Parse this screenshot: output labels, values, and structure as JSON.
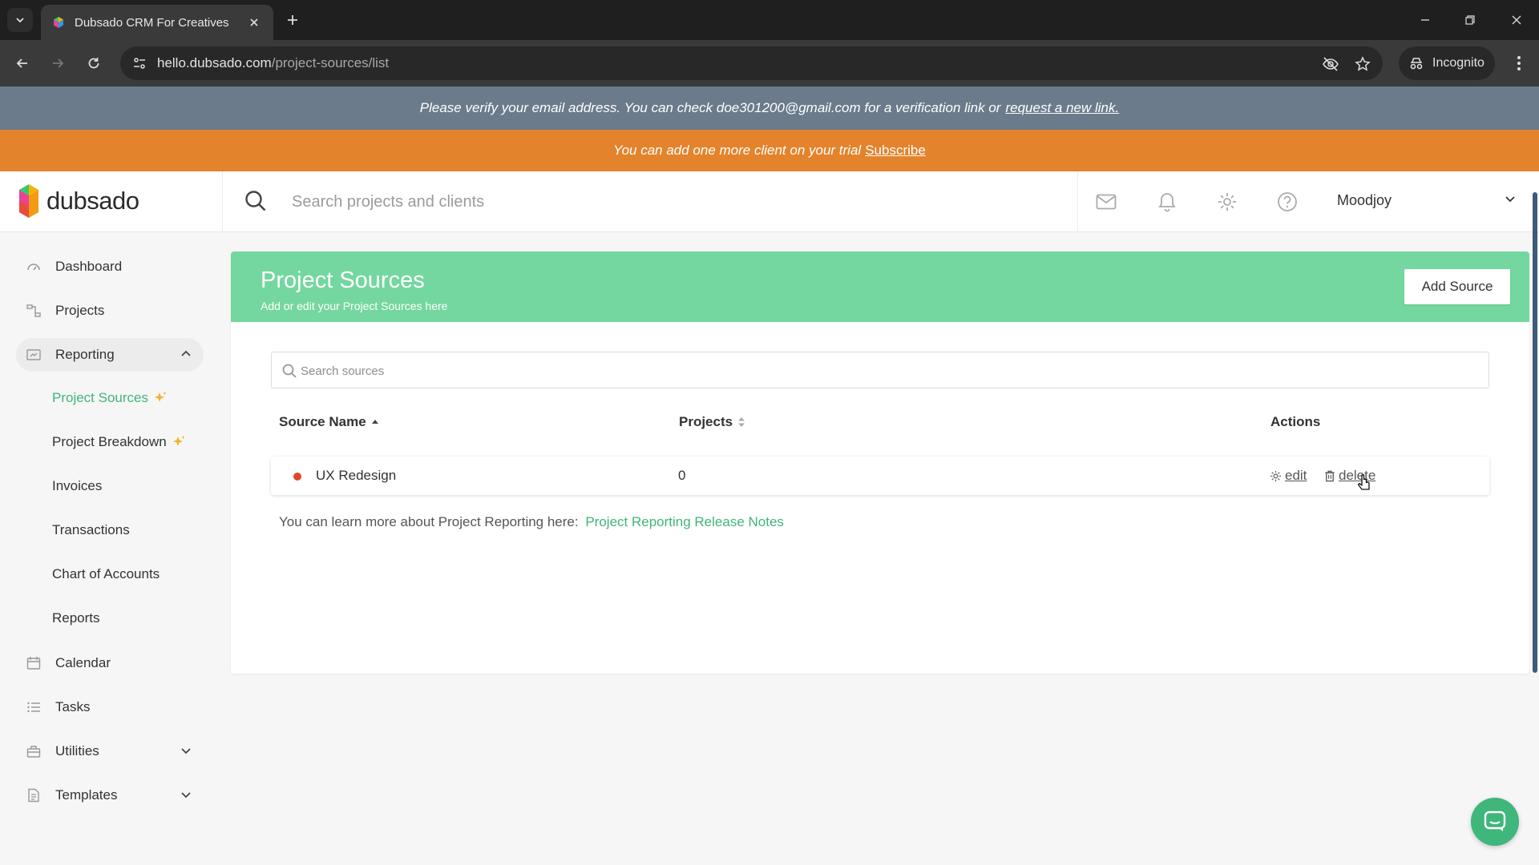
{
  "browser": {
    "tab_title": "Dubsado CRM For Creatives",
    "url_host": "hello.dubsado.com",
    "url_path": "/project-sources/list",
    "incognito_label": "Incognito"
  },
  "banners": {
    "verify_text": "Please verify your email address. You can check doe301200@gmail.com for a verification link or",
    "verify_link": "request a new link.",
    "trial_text": "You can add one more client on your trial",
    "trial_link": "Subscribe"
  },
  "header": {
    "logo_text": "dubsado",
    "search_placeholder": "Search projects and clients",
    "user_name": "Moodjoy"
  },
  "sidebar": {
    "items": [
      {
        "label": "Dashboard"
      },
      {
        "label": "Projects"
      },
      {
        "label": "Reporting"
      },
      {
        "label": "Calendar"
      },
      {
        "label": "Tasks"
      },
      {
        "label": "Utilities"
      },
      {
        "label": "Templates"
      }
    ],
    "reporting_sub": [
      {
        "label": "Project Sources"
      },
      {
        "label": "Project Breakdown"
      },
      {
        "label": "Invoices"
      },
      {
        "label": "Transactions"
      },
      {
        "label": "Chart of Accounts"
      },
      {
        "label": "Reports"
      }
    ]
  },
  "main": {
    "title": "Project Sources",
    "subtitle": "Add or edit your Project Sources here",
    "add_button": "Add Source",
    "search_placeholder": "Search sources",
    "columns": {
      "source_name": "Source Name",
      "projects": "Projects",
      "actions": "Actions"
    },
    "rows": [
      {
        "name": "UX Redesign",
        "projects": "0",
        "dot_color": "#e0462c"
      }
    ],
    "action_edit": "edit",
    "action_delete": "delete",
    "learn_text": "You can learn more about Project Reporting here:",
    "learn_link": "Project Reporting Release Notes"
  },
  "colors": {
    "brand_green": "#74d79f",
    "link_green": "#3fb67a",
    "trial_orange": "#e3832b",
    "verify_slate": "#6b7b8c"
  }
}
